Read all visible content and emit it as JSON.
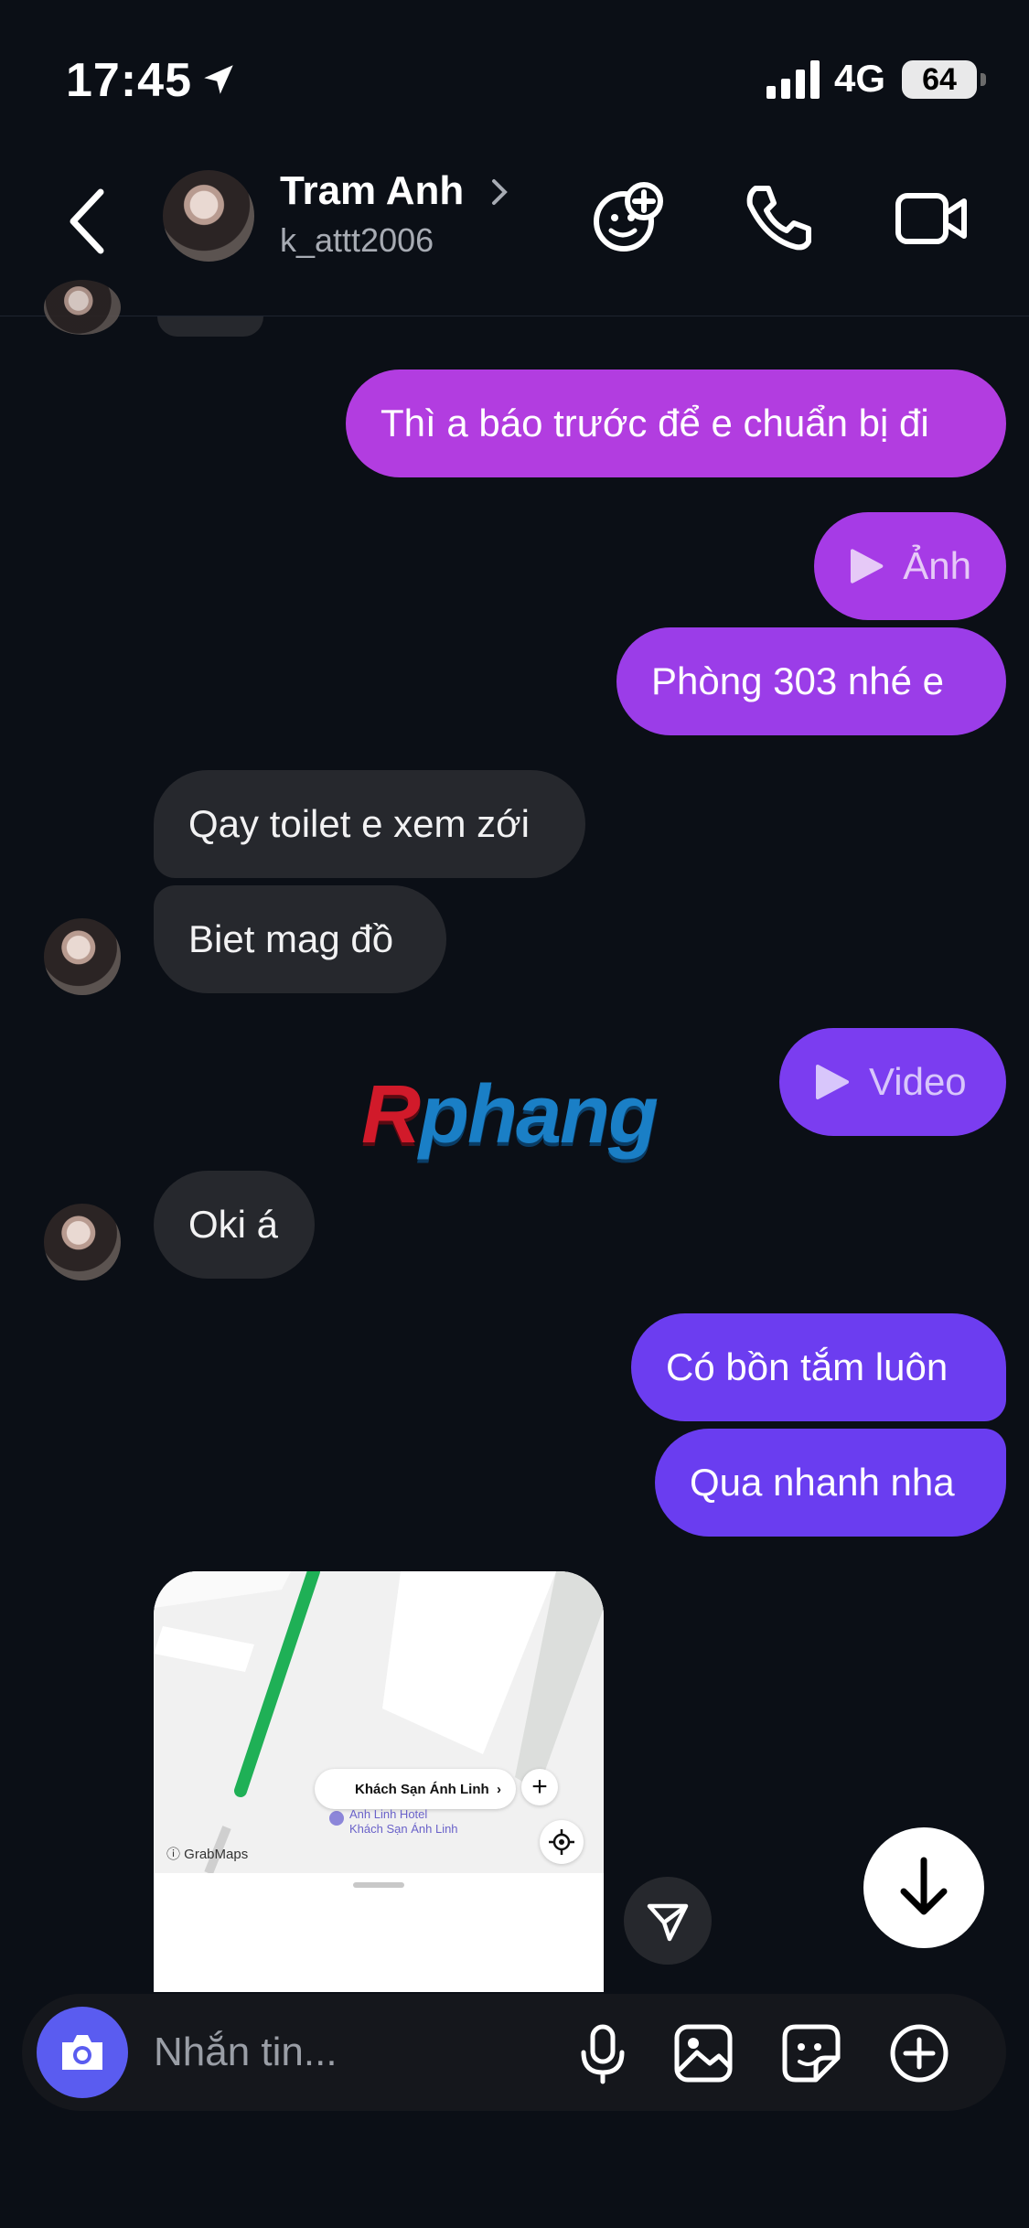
{
  "status_bar": {
    "time": "17:45",
    "network": "4G",
    "battery": "64"
  },
  "header": {
    "name": "Tram Anh",
    "username": "k_attt2006",
    "icons": [
      "back-icon",
      "sticker-add-icon",
      "phone-icon",
      "video-camera-icon"
    ]
  },
  "messages": [
    {
      "text": "Thì a báo trước để e chuẩn bị đi",
      "direction": "outgoing"
    },
    {
      "text": "Ảnh",
      "direction": "outgoing",
      "kind": "media"
    },
    {
      "text": "Phòng 303 nhé e",
      "direction": "outgoing"
    },
    {
      "text": "Qay toilet e xem zới",
      "direction": "incoming"
    },
    {
      "text": "Biet mag đồ",
      "direction": "incoming"
    },
    {
      "text": "Video",
      "direction": "outgoing",
      "kind": "media"
    },
    {
      "text": "Oki á",
      "direction": "incoming"
    },
    {
      "text": "Có bồn tắm luôn",
      "direction": "outgoing"
    },
    {
      "text": "Qua nhanh nha",
      "direction": "outgoing"
    }
  ],
  "watermark": {
    "r": "R",
    "rest": "phang"
  },
  "map_card": {
    "place_name": "Khách Sạn Ánh Linh",
    "sub_line_1": "Anh Linh Hotel",
    "sub_line_2": "Khách Sạn Ánh Linh",
    "brand": "GrabMaps",
    "plus": "+",
    "chevron": "›"
  },
  "composer": {
    "placeholder": "Nhắn tin..."
  },
  "colors": {
    "background": "#0b0f16",
    "incoming_bubble": "#26282d",
    "outgoing_gradient_top": "#b23de0",
    "outgoing_gradient_bottom": "#6a3df0",
    "camera_button": "#5a5cf0"
  }
}
